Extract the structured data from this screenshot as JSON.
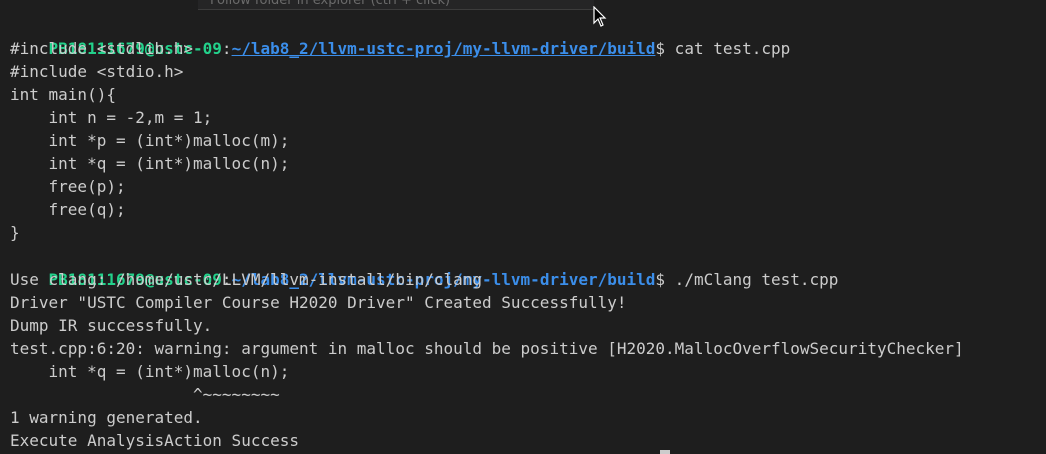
{
  "tooltip": {
    "text": "Follow folder in explorer (ctrl + click)"
  },
  "prompt": {
    "user": "PB18111679@ustc-09",
    "separator": ":",
    "path": "~/lab8_2/llvm-ustc-proj/my-llvm-driver/build",
    "dollar": "$"
  },
  "commands": {
    "cat": " cat test.cpp",
    "run": " ./mClang test.cpp"
  },
  "source_lines": [
    "#include <stdlib.h>",
    "#include <stdio.h>",
    "int main(){",
    "    int n = -2,m = 1;",
    "    int *p = (int*)malloc(m);",
    "    int *q = (int*)malloc(n);",
    "    free(p);",
    "    free(q);",
    "}"
  ],
  "output_lines": [
    "Use clang: /home/ustc/LLVM/llvm-install/bin/clang",
    "Driver \"USTC Compiler Course H2020 Driver\" Created Successfully!",
    "Dump IR successfully.",
    "test.cpp:6:20: warning: argument in malloc should be positive [H2020.MallocOverflowSecurityChecker]",
    "    int *q = (int*)malloc(n);",
    "                   ^~~~~~~~~",
    "1 warning generated.",
    "Execute AnalysisAction Success"
  ],
  "colors": {
    "background": "#1e1e1e",
    "prompt_user": "#23d18b",
    "prompt_path": "#3b8eea",
    "text": "#cccccc"
  },
  "icons": {
    "cursor": "mouse-pointer-icon"
  }
}
